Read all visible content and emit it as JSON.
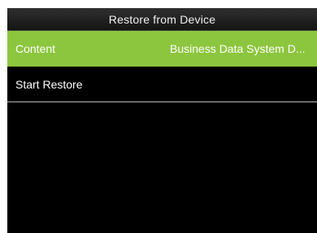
{
  "title": "Restore from Device",
  "colors": {
    "accent": "#8cc63e",
    "background": "#000000",
    "text": "#ffffff"
  },
  "menu": {
    "items": [
      {
        "label": "Content",
        "value": "Business Data System D...",
        "selected": true
      },
      {
        "label": "Start Restore",
        "value": "",
        "selected": false
      }
    ]
  }
}
